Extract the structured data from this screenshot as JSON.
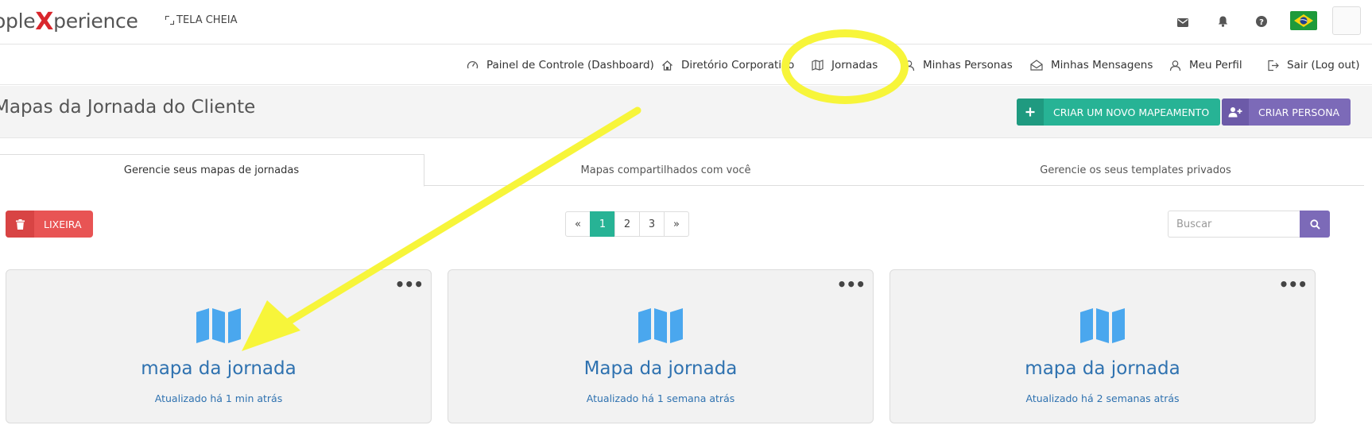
{
  "header": {
    "logo_prefix": "ople",
    "logo_x": "X",
    "logo_suffix": "perience",
    "fullscreen_label": "TELA CHEIA",
    "icons": [
      "mail-icon",
      "bell-icon",
      "help-icon",
      "brazil-flag-icon",
      "avatar"
    ]
  },
  "nav": {
    "items": [
      {
        "label": "Painel de Controle (Dashboard)",
        "icon": "dashboard-icon"
      },
      {
        "label": "Diretório Corporativo",
        "icon": "home-icon"
      },
      {
        "label": "Jornadas",
        "icon": "map-icon"
      },
      {
        "label": "Minhas Personas",
        "icon": "user-icon"
      },
      {
        "label": "Minhas Mensagens",
        "icon": "envelope-open-icon"
      },
      {
        "label": "Meu Perfil",
        "icon": "user-icon"
      },
      {
        "label": "Sair (Log out)",
        "icon": "sign-out-icon"
      }
    ]
  },
  "page": {
    "title": "Mapas da Jornada do Cliente",
    "create_map_label": "CRIAR UM NOVO MAPEAMENTO",
    "create_persona_label": "CRIAR PERSONA"
  },
  "tabs": [
    {
      "label": "Gerencie seus mapas de jornadas",
      "active": true
    },
    {
      "label": "Mapas compartilhados com você",
      "active": false
    },
    {
      "label": "Gerencie os seus templates privados",
      "active": false
    }
  ],
  "toolbar": {
    "trash_label": "LIXEIRA",
    "pagination": [
      "«",
      "1",
      "2",
      "3",
      "»"
    ],
    "current_page": "1",
    "search_placeholder": "Buscar"
  },
  "cards": [
    {
      "title": "mapa da jornada",
      "updated": "Atualizado há 1 min atrás"
    },
    {
      "title": "Mapa da jornada",
      "updated": "Atualizado há 1 semana atrás"
    },
    {
      "title": "mapa da jornada",
      "updated": "Atualizado há 2 semanas atrás"
    }
  ],
  "colors": {
    "accent_green": "#27b395",
    "accent_purple": "#7c6ab8",
    "danger_red": "#e85454",
    "link_blue": "#2f72b0",
    "map_icon_blue": "#4aa7ee",
    "annotation_yellow": "#f7f53a"
  }
}
